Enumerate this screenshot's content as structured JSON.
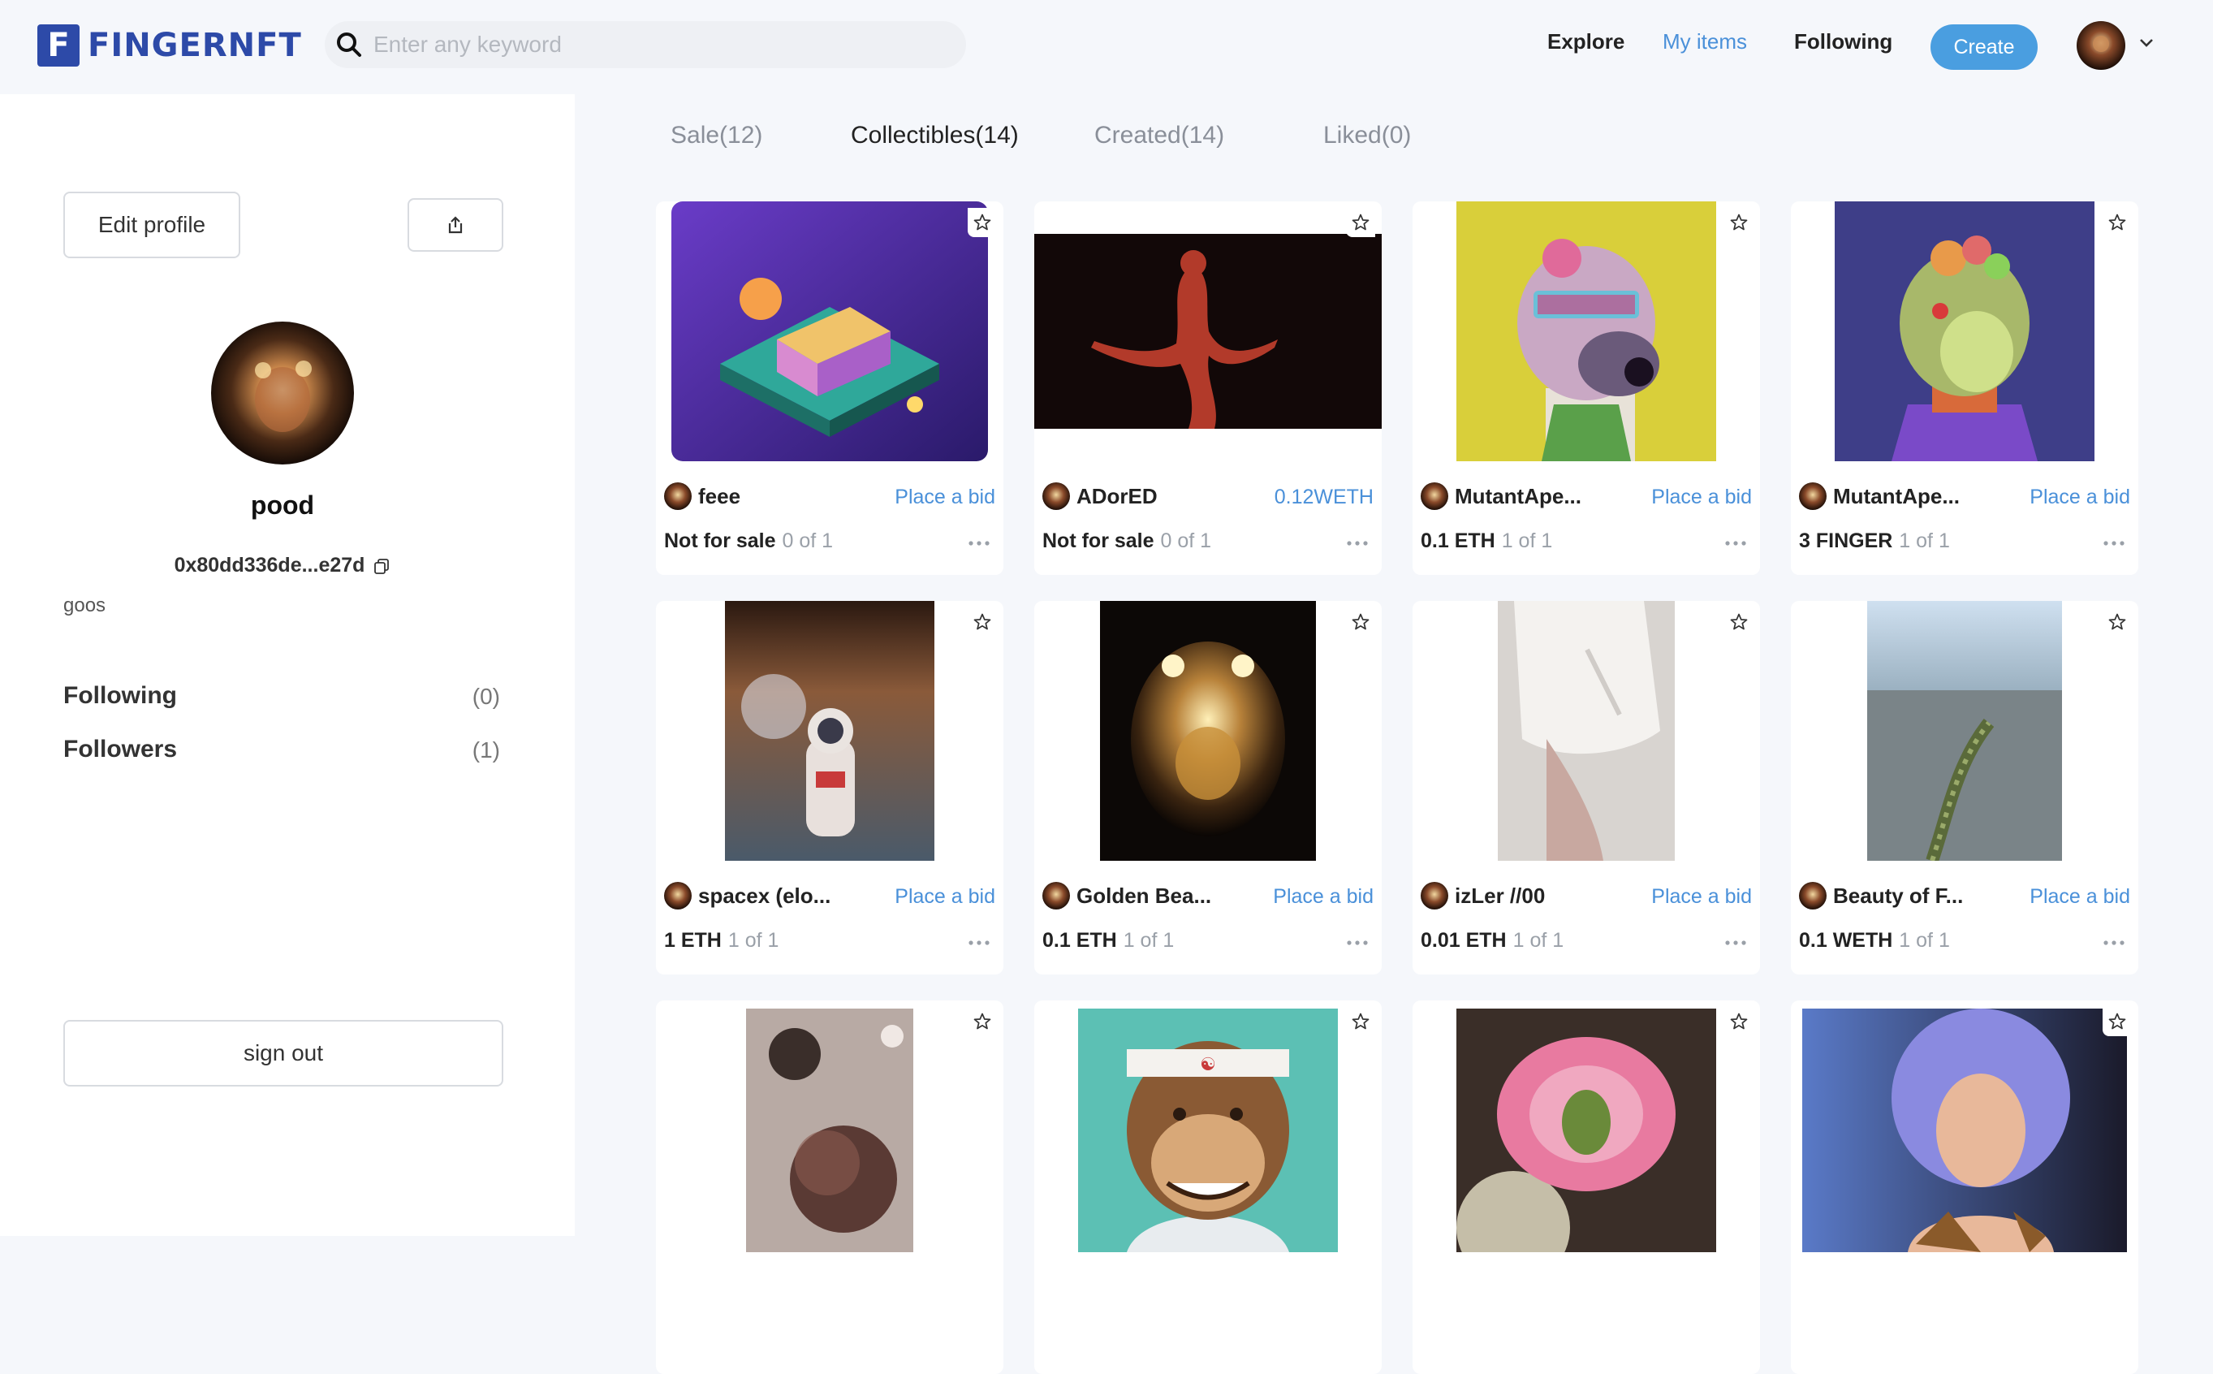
{
  "brand": {
    "logo_letter": "F",
    "name": "FINGERNFT",
    "accent": "#2d4aa8"
  },
  "search": {
    "placeholder": "Enter any keyword"
  },
  "nav": {
    "explore": "Explore",
    "my_items": "My items",
    "following": "Following",
    "create": "Create"
  },
  "profile": {
    "edit_label": "Edit profile",
    "username": "pood",
    "address": "0x80dd336de...e27d",
    "bio": "goos",
    "following_label": "Following",
    "following_count": "(0)",
    "followers_label": "Followers",
    "followers_count": "(1)",
    "signout_label": "sign out"
  },
  "tabs": [
    "Sale(12)",
    "Collectibles(14)",
    "Created(14)",
    "Liked(0)"
  ],
  "active_tab": "Collectibles(14)",
  "cards": [
    {
      "name": "feee",
      "action": "Place a bid",
      "price": "Not for sale",
      "edition": "0 of 1",
      "art": "isometric-house"
    },
    {
      "name": "ADorED",
      "action": "0.12WETH",
      "price": "Not for sale",
      "edition": "0 of 1",
      "art": "red-figure"
    },
    {
      "name": "MutantApe...",
      "action": "Place a bid",
      "price": "0.1 ETH",
      "edition": "1 of 1",
      "art": "mutant-ape-yellow"
    },
    {
      "name": "MutantApe...",
      "action": "Place a bid",
      "price": "3 FINGER",
      "edition": "1 of 1",
      "art": "mutant-ape-blue"
    },
    {
      "name": "spacex (elo...",
      "action": "Place a bid",
      "price": "1 ETH",
      "edition": "1 of 1",
      "art": "astronaut"
    },
    {
      "name": "Golden Bea...",
      "action": "Place a bid",
      "price": "0.1 ETH",
      "edition": "1 of 1",
      "art": "golden-bear"
    },
    {
      "name": "izLer //00",
      "action": "Place a bid",
      "price": "0.01 ETH",
      "edition": "1 of 1",
      "art": "white-dress"
    },
    {
      "name": "Beauty of F...",
      "action": "Place a bid",
      "price": "0.1 WETH",
      "edition": "1 of 1",
      "art": "beach"
    },
    {
      "name": "",
      "action": "",
      "price": "",
      "edition": "",
      "art": "spheres"
    },
    {
      "name": "",
      "action": "",
      "price": "",
      "edition": "",
      "art": "bored-ape-headband"
    },
    {
      "name": "",
      "action": "",
      "price": "",
      "edition": "",
      "art": "pink-flower"
    },
    {
      "name": "",
      "action": "",
      "price": "",
      "edition": "",
      "art": "blue-hair-girl"
    }
  ]
}
